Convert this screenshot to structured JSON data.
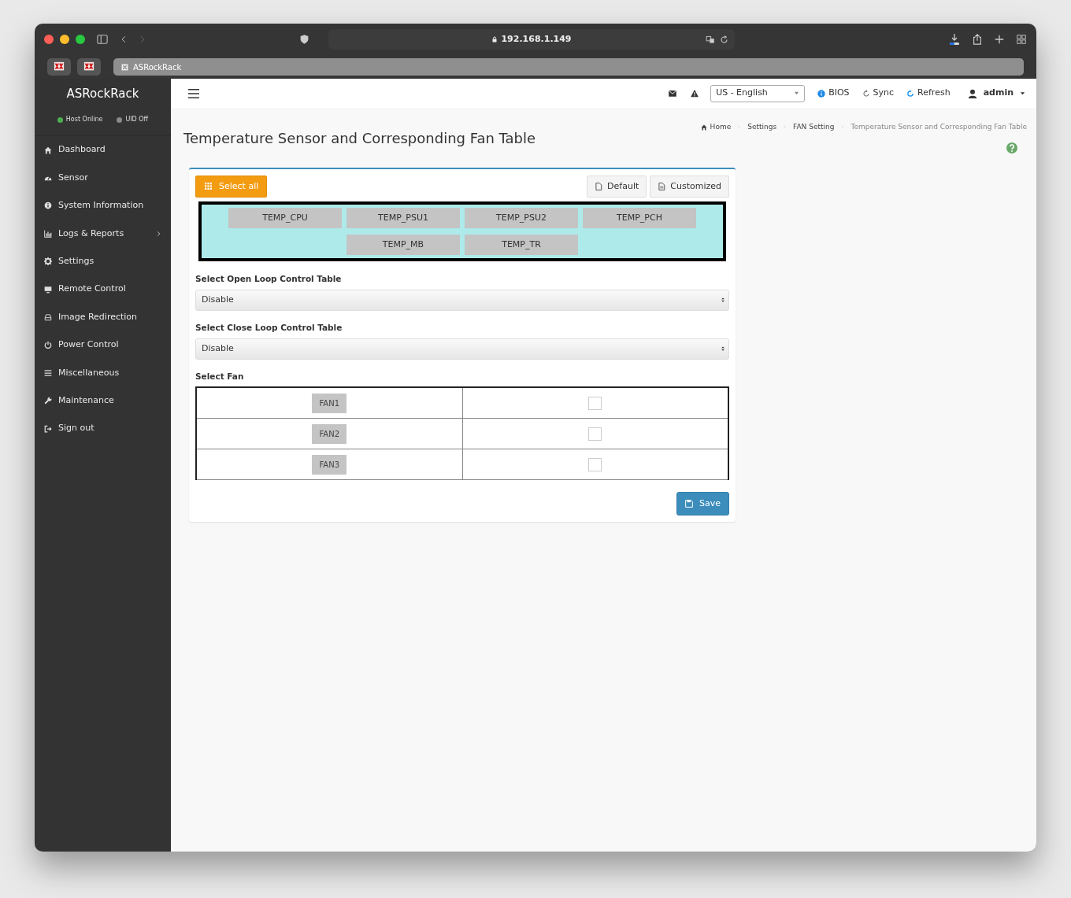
{
  "browser": {
    "url": "192.168.1.149",
    "tab_title": "ASRockRack"
  },
  "sidebar": {
    "brand": "ASRockRack",
    "status": [
      {
        "label": "Host Online",
        "color": "#4caf50"
      },
      {
        "label": "UID Off",
        "color": "#8a8a8a"
      }
    ],
    "items": [
      {
        "label": "Dashboard",
        "submenu": false
      },
      {
        "label": "Sensor",
        "submenu": false
      },
      {
        "label": "System Information",
        "submenu": false
      },
      {
        "label": "Logs & Reports",
        "submenu": true
      },
      {
        "label": "Settings",
        "submenu": false
      },
      {
        "label": "Remote Control",
        "submenu": false
      },
      {
        "label": "Image Redirection",
        "submenu": false
      },
      {
        "label": "Power Control",
        "submenu": false
      },
      {
        "label": "Miscellaneous",
        "submenu": false
      },
      {
        "label": "Maintenance",
        "submenu": false
      },
      {
        "label": "Sign out",
        "submenu": false
      }
    ]
  },
  "topbar": {
    "language": "US - English",
    "links": [
      "BIOS",
      "Sync",
      "Refresh"
    ],
    "user": "admin"
  },
  "breadcrumb": [
    "Home",
    "Settings",
    "FAN Setting",
    "Temperature Sensor and Corresponding Fan Table"
  ],
  "page_title": "Temperature Sensor and Corresponding Fan Table",
  "toolbar": {
    "select_all": "Select all",
    "buttons": [
      "Default",
      "Customized"
    ]
  },
  "sensors": [
    "TEMP_CPU",
    "TEMP_PSU1",
    "TEMP_PSU2",
    "TEMP_PCH",
    "TEMP_MB",
    "TEMP_TR"
  ],
  "selects": [
    {
      "label": "Select Open Loop Control Table",
      "value": "Disable"
    },
    {
      "label": "Select Close Loop Control Table",
      "value": "Disable"
    }
  ],
  "fan_label": "Select Fan",
  "fans": [
    {
      "label": "FAN1",
      "checked": false
    },
    {
      "label": "FAN2",
      "checked": false
    },
    {
      "label": "FAN3",
      "checked": false
    }
  ],
  "save": "Save"
}
